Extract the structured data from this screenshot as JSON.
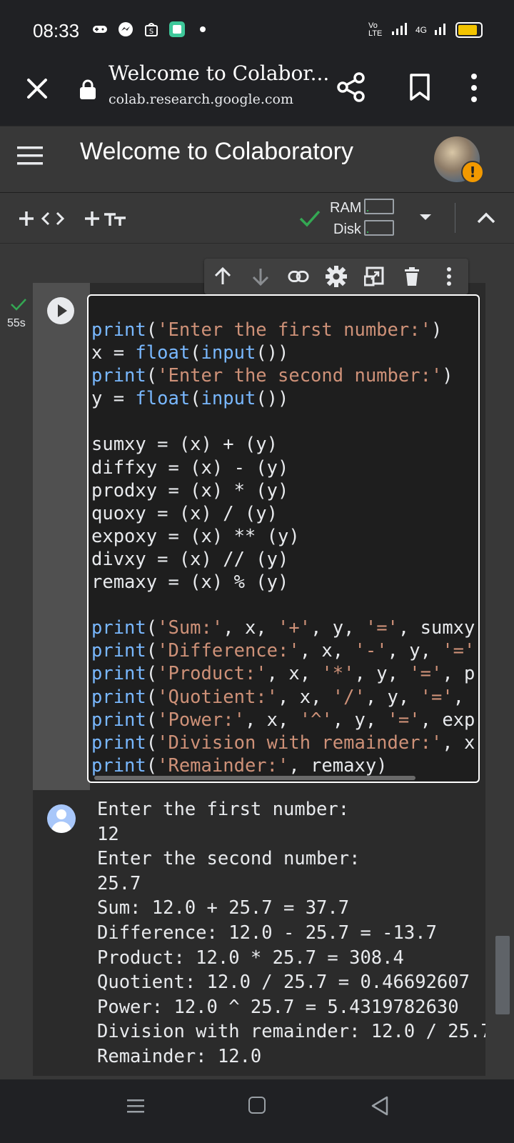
{
  "status_bar": {
    "time": "08:33",
    "network_label": "4G",
    "volte_label": "Vo LTE",
    "battery_color": "#f3c400"
  },
  "browser": {
    "page_title": "Welcome to Colabor...",
    "url": "colab.research.google.com"
  },
  "colab": {
    "notebook_title": "Welcome to Colaboratory",
    "warning_badge": "!"
  },
  "toolbar": {
    "ram_label": "RAM",
    "disk_label": "Disk",
    "ram_usage_fraction": 0.05,
    "disk_usage_fraction": 0.05,
    "status_color": "#34a853"
  },
  "cell": {
    "exec_time": "55s",
    "code_lines": [
      [
        {
          "t": "fn",
          "v": "print"
        },
        {
          "t": "p",
          "v": "("
        },
        {
          "t": "str",
          "v": "'Enter the first number:'"
        },
        {
          "t": "p",
          "v": ")"
        }
      ],
      [
        {
          "t": "p",
          "v": "x = "
        },
        {
          "t": "fn",
          "v": "float"
        },
        {
          "t": "p",
          "v": "("
        },
        {
          "t": "fn",
          "v": "input"
        },
        {
          "t": "p",
          "v": "())"
        }
      ],
      [
        {
          "t": "fn",
          "v": "print"
        },
        {
          "t": "p",
          "v": "("
        },
        {
          "t": "str",
          "v": "'Enter the second number:'"
        },
        {
          "t": "p",
          "v": ")"
        }
      ],
      [
        {
          "t": "p",
          "v": "y = "
        },
        {
          "t": "fn",
          "v": "float"
        },
        {
          "t": "p",
          "v": "("
        },
        {
          "t": "fn",
          "v": "input"
        },
        {
          "t": "p",
          "v": "())"
        }
      ],
      [],
      [
        {
          "t": "p",
          "v": "sumxy = (x) + (y)"
        }
      ],
      [
        {
          "t": "p",
          "v": "diffxy = (x) - (y)"
        }
      ],
      [
        {
          "t": "p",
          "v": "prodxy = (x) * (y)"
        }
      ],
      [
        {
          "t": "p",
          "v": "quoxy = (x) / (y)"
        }
      ],
      [
        {
          "t": "p",
          "v": "expoxy = (x) ** (y)"
        }
      ],
      [
        {
          "t": "p",
          "v": "divxy = (x) // (y)"
        }
      ],
      [
        {
          "t": "p",
          "v": "remaxy = (x) % (y)"
        }
      ],
      [],
      [
        {
          "t": "fn",
          "v": "print"
        },
        {
          "t": "p",
          "v": "("
        },
        {
          "t": "str",
          "v": "'Sum:'"
        },
        {
          "t": "p",
          "v": ", x, "
        },
        {
          "t": "str",
          "v": "'+'"
        },
        {
          "t": "p",
          "v": ", y, "
        },
        {
          "t": "str",
          "v": "'='"
        },
        {
          "t": "p",
          "v": ", sumxy"
        }
      ],
      [
        {
          "t": "fn",
          "v": "print"
        },
        {
          "t": "p",
          "v": "("
        },
        {
          "t": "str",
          "v": "'Difference:'"
        },
        {
          "t": "p",
          "v": ", x, "
        },
        {
          "t": "str",
          "v": "'-'"
        },
        {
          "t": "p",
          "v": ", y, "
        },
        {
          "t": "str",
          "v": "'='"
        }
      ],
      [
        {
          "t": "fn",
          "v": "print"
        },
        {
          "t": "p",
          "v": "("
        },
        {
          "t": "str",
          "v": "'Product:'"
        },
        {
          "t": "p",
          "v": ", x, "
        },
        {
          "t": "str",
          "v": "'*'"
        },
        {
          "t": "p",
          "v": ", y, "
        },
        {
          "t": "str",
          "v": "'='"
        },
        {
          "t": "p",
          "v": ", p"
        }
      ],
      [
        {
          "t": "fn",
          "v": "print"
        },
        {
          "t": "p",
          "v": "("
        },
        {
          "t": "str",
          "v": "'Quotient:'"
        },
        {
          "t": "p",
          "v": ", x, "
        },
        {
          "t": "str",
          "v": "'/'"
        },
        {
          "t": "p",
          "v": ", y, "
        },
        {
          "t": "str",
          "v": "'='"
        },
        {
          "t": "p",
          "v": ","
        }
      ],
      [
        {
          "t": "fn",
          "v": "print"
        },
        {
          "t": "p",
          "v": "("
        },
        {
          "t": "str",
          "v": "'Power:'"
        },
        {
          "t": "p",
          "v": ", x, "
        },
        {
          "t": "str",
          "v": "'^'"
        },
        {
          "t": "p",
          "v": ", y, "
        },
        {
          "t": "str",
          "v": "'='"
        },
        {
          "t": "p",
          "v": ", exp"
        }
      ],
      [
        {
          "t": "fn",
          "v": "print"
        },
        {
          "t": "p",
          "v": "("
        },
        {
          "t": "str",
          "v": "'Division with remainder:'"
        },
        {
          "t": "p",
          "v": ", x"
        }
      ],
      [
        {
          "t": "fn",
          "v": "print"
        },
        {
          "t": "p",
          "v": "("
        },
        {
          "t": "str",
          "v": "'Remainder:'"
        },
        {
          "t": "p",
          "v": ", remaxy)"
        }
      ]
    ],
    "output_lines": [
      "Enter the first number:",
      "12",
      "Enter the second number:",
      "25.7",
      "Sum: 12.0 + 25.7 = 37.7",
      "Difference: 12.0 - 25.7 = -13.7",
      "Product: 12.0 * 25.7 = 308.4",
      "Quotient: 12.0 / 25.7 = 0.46692607",
      "Power: 12.0 ^ 25.7 = 5.4319782630",
      "Division with remainder: 12.0 / 25.7",
      "Remainder: 12.0"
    ]
  },
  "icons": {
    "close": "close-icon",
    "lock": "lock-icon",
    "share": "share-icon",
    "bookmark": "bookmark-icon",
    "more": "more-vert-icon",
    "menu": "hamburger-menu-icon"
  }
}
